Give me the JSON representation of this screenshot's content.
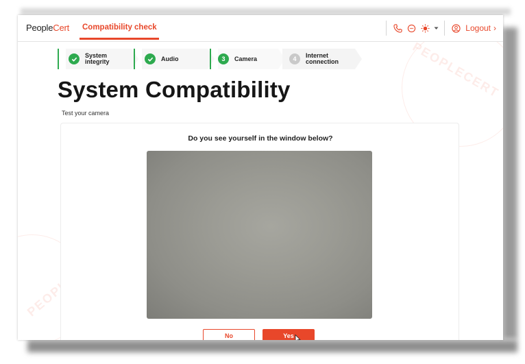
{
  "brand": {
    "people": "People",
    "cert": "Cert"
  },
  "nav": {
    "active_tab": "Compatibility check"
  },
  "toolbar": {
    "logout_label": "Logout"
  },
  "steps": [
    {
      "label": "System integrity",
      "state": "done",
      "icon": "check-icon"
    },
    {
      "label": "Audio",
      "state": "done",
      "icon": "check-icon"
    },
    {
      "label": "Camera",
      "state": "active",
      "number": "3"
    },
    {
      "label": "Internet connection",
      "state": "pending",
      "number": "4"
    }
  ],
  "page": {
    "title": "System Compatibility",
    "subtitle": "Test your camera",
    "question": "Do you see yourself in the window below?"
  },
  "actions": {
    "no_label": "No",
    "yes_label": "Yes"
  },
  "watermark": {
    "text": "PEOPLECERT"
  },
  "colors": {
    "accent": "#e8472a",
    "success": "#2eaa4f",
    "pending": "#c9c9c9"
  }
}
